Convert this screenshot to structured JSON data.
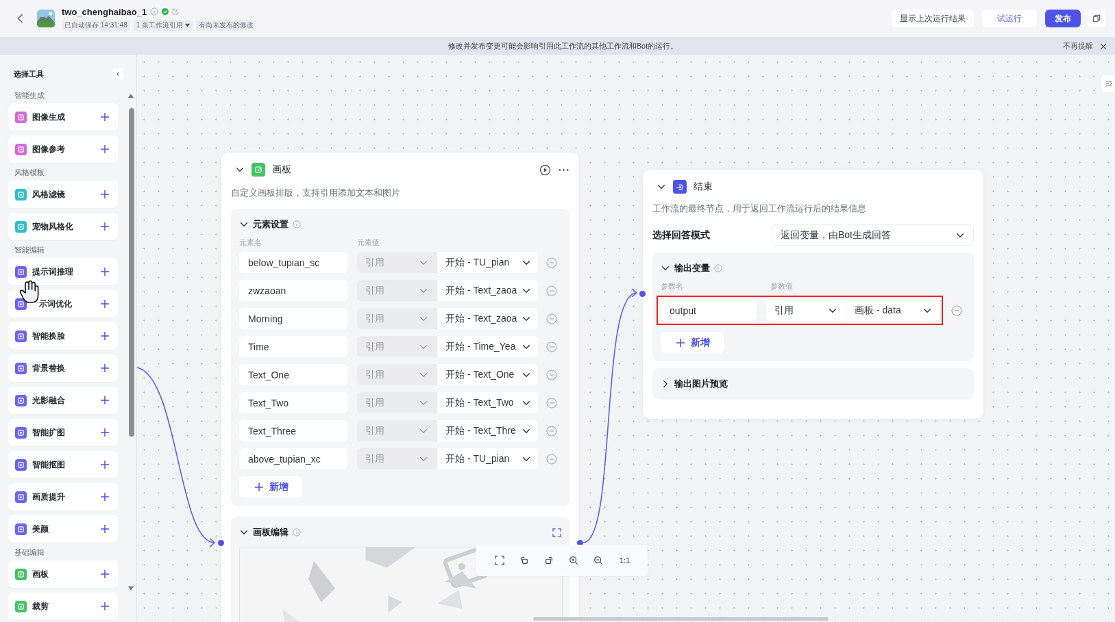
{
  "header": {
    "title": "two_chenghaibao_1",
    "autosave": "已自动保存 14:31:48",
    "references": "1 条工作流引用",
    "unpublished": "有尚未发布的修改",
    "buttons": [
      {
        "label": "显示上次运行结果",
        "kind": "plain"
      },
      {
        "label": "试运行",
        "kind": "accent"
      },
      {
        "label": "发布",
        "kind": "primary"
      }
    ]
  },
  "banner": {
    "message": "修改并发布变更可能会影响引用此工作流的其他工作流和Bot的运行。",
    "dismiss": "不再提醒"
  },
  "sidebar": {
    "title": "选择工具",
    "groups": [
      {
        "label": "智能生成",
        "items": [
          {
            "label": "图像生成",
            "color": "#d46ad8"
          },
          {
            "label": "图像参考",
            "color": "#d46ad8"
          }
        ]
      },
      {
        "label": "风格模板",
        "items": [
          {
            "label": "风格滤镜",
            "color": "#2ebfc9"
          },
          {
            "label": "宠物风格化",
            "color": "#2ebfc9"
          }
        ]
      },
      {
        "label": "智能编辑",
        "items": [
          {
            "label": "提示词推理",
            "color": "#6b64ef"
          },
          {
            "label": "示词优化",
            "color": "#6b64ef",
            "cursor": true
          },
          {
            "label": "智能换脸",
            "color": "#6b64ef"
          },
          {
            "label": "背景替换",
            "color": "#6b64ef"
          },
          {
            "label": "光影融合",
            "color": "#6b64ef"
          },
          {
            "label": "智能扩图",
            "color": "#6b64ef"
          },
          {
            "label": "智能抠图",
            "color": "#6b64ef"
          },
          {
            "label": "画质提升",
            "color": "#6b64ef"
          },
          {
            "label": "美颜",
            "color": "#6b64ef"
          }
        ]
      },
      {
        "label": "基础编辑",
        "items": [
          {
            "label": "画板",
            "color": "#45c266"
          },
          {
            "label": "裁剪",
            "color": "#45c266"
          }
        ]
      }
    ]
  },
  "canvas_node": {
    "title": "画板",
    "description": "自定义画板排版，支持引用添加文本和图片",
    "elements": {
      "title": "元素设置",
      "expanded": true,
      "columns": [
        "元素名",
        "元素值"
      ],
      "rows": [
        {
          "name": "below_tupian_sc",
          "source": "引用",
          "disabled": true,
          "value": "开始 - TU_pian"
        },
        {
          "name": "zwzaoan",
          "source": "引用",
          "disabled": true,
          "value": "开始 - Text_zaoa"
        },
        {
          "name": "Morning",
          "source": "引用",
          "disabled": true,
          "value": "开始 - Text_zaoa"
        },
        {
          "name": "Time",
          "source": "引用",
          "disabled": true,
          "value": "开始 - Time_Yea"
        },
        {
          "name": "Text_One",
          "source": "引用",
          "disabled": true,
          "value": "开始 - Text_One"
        },
        {
          "name": "Text_Two",
          "source": "引用",
          "disabled": true,
          "value": "开始 - Text_Two"
        },
        {
          "name": "Text_Three",
          "source": "引用",
          "disabled": true,
          "value": "开始 - Text_Thre"
        },
        {
          "name": "above_tupian_xc",
          "source": "引用",
          "disabled": true,
          "value": "开始 - TU_pian"
        }
      ],
      "add": "新增"
    },
    "editor": {
      "title": "画板编辑",
      "expanded": true
    }
  },
  "end_node": {
    "title": "结束",
    "description": "工作流的最终节点，用于返回工作流运行后的结果信息",
    "mode_label": "选择回答模式",
    "mode_value": "返回变量，由Bot生成回答",
    "outputs": {
      "title": "输出变量",
      "expanded": true,
      "columns": [
        "参数名",
        "参数值"
      ],
      "rows": [
        {
          "name": "output",
          "source": "引用",
          "disabled": false,
          "value": "画板 - data",
          "highlighted": true
        }
      ],
      "add": "新增"
    },
    "preview": {
      "title": "输出图片预览",
      "expanded": false
    }
  },
  "toolbar": {
    "zoom_reset": "1:1"
  }
}
